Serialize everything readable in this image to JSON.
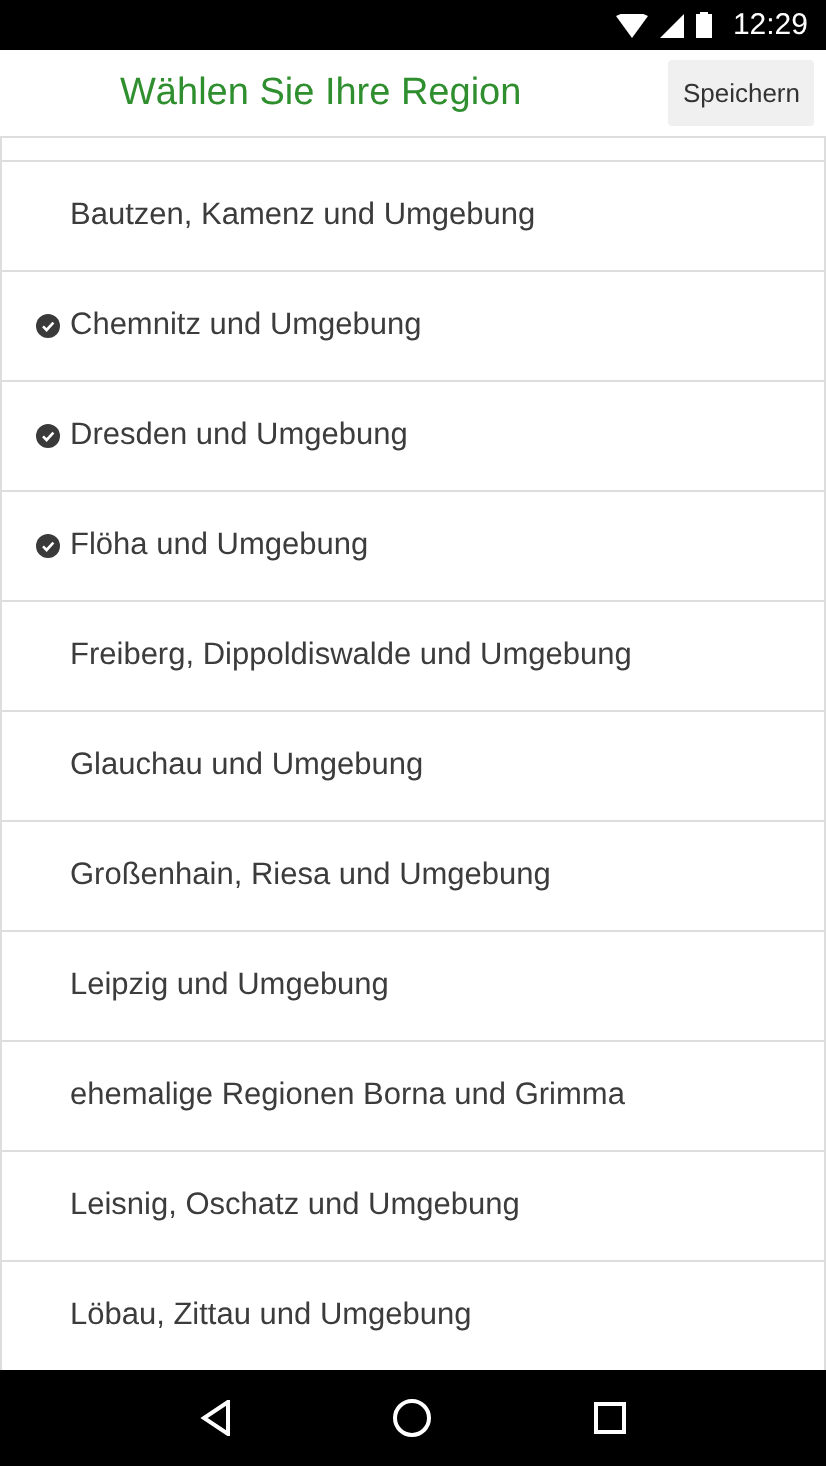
{
  "status_bar": {
    "time": "12:29"
  },
  "header": {
    "title": "Wählen Sie Ihre Region",
    "save_button": "Speichern"
  },
  "regions": [
    {
      "label": "Bautzen, Kamenz und Umgebung",
      "selected": false
    },
    {
      "label": "Chemnitz und Umgebung",
      "selected": true
    },
    {
      "label": "Dresden und Umgebung",
      "selected": true
    },
    {
      "label": "Flöha und Umgebung",
      "selected": true
    },
    {
      "label": "Freiberg, Dippoldiswalde und Umgebung",
      "selected": false
    },
    {
      "label": "Glauchau und Umgebung",
      "selected": false
    },
    {
      "label": "Großenhain, Riesa und Umgebung",
      "selected": false
    },
    {
      "label": "Leipzig und Umgebung",
      "selected": false
    },
    {
      "label": "ehemalige Regionen Borna und Grimma",
      "selected": false
    },
    {
      "label": "Leisnig, Oschatz und Umgebung",
      "selected": false
    },
    {
      "label": "Löbau, Zittau und Umgebung",
      "selected": false
    }
  ]
}
